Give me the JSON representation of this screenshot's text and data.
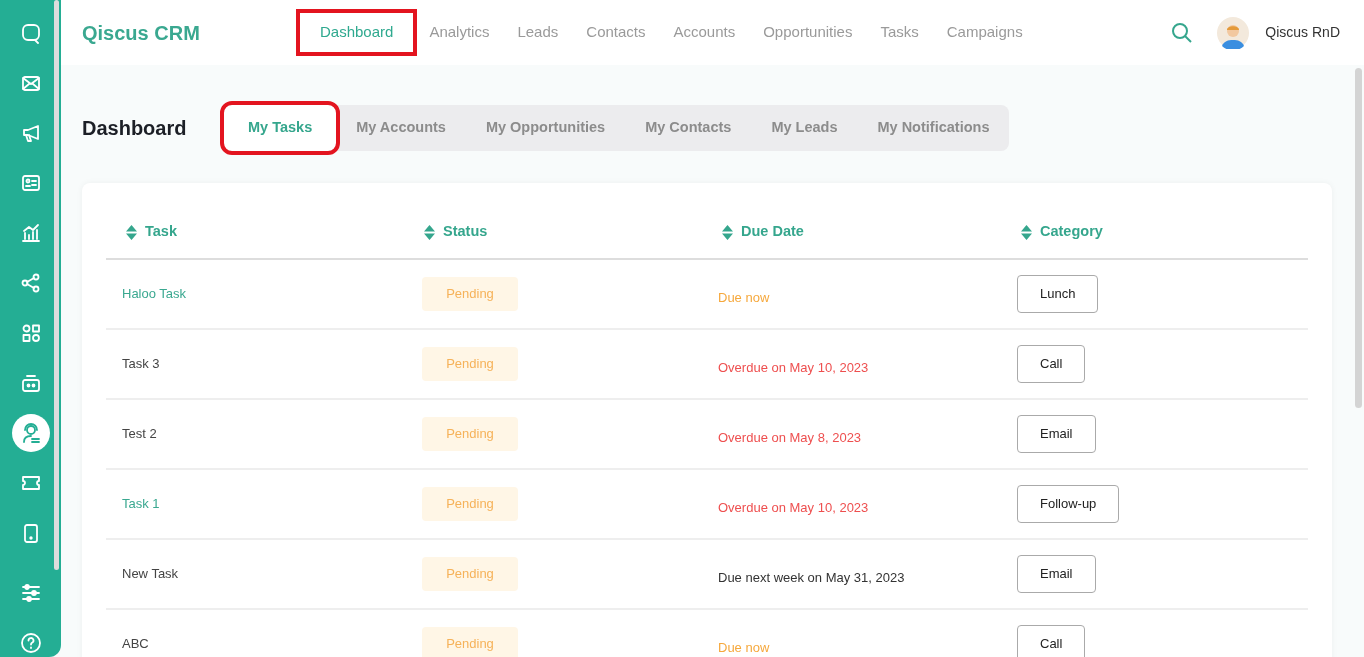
{
  "sidebar": {
    "items": [
      {
        "selected": false
      },
      {
        "selected": false
      },
      {
        "selected": false
      },
      {
        "selected": false
      },
      {
        "selected": false
      },
      {
        "selected": false
      },
      {
        "selected": false
      },
      {
        "selected": false
      },
      {
        "selected": true
      },
      {
        "selected": false
      },
      {
        "selected": false
      }
    ],
    "bottom_items": [
      {
        "selected": false
      },
      {
        "selected": false
      }
    ]
  },
  "brand": "Qiscus CRM",
  "nav": [
    {
      "label": "Dashboard",
      "selected": true,
      "highlighted": true
    },
    {
      "label": "Analytics",
      "selected": false,
      "highlighted": false
    },
    {
      "label": "Leads",
      "selected": false,
      "highlighted": false
    },
    {
      "label": "Contacts",
      "selected": false,
      "highlighted": false
    },
    {
      "label": "Accounts",
      "selected": false,
      "highlighted": false
    },
    {
      "label": "Opportunities",
      "selected": false,
      "highlighted": false
    },
    {
      "label": "Tasks",
      "selected": false,
      "highlighted": false
    },
    {
      "label": "Campaigns",
      "selected": false,
      "highlighted": false
    }
  ],
  "user": {
    "name": "Qiscus RnD"
  },
  "page_title": "Dashboard",
  "tabs": [
    {
      "label": "My Tasks",
      "selected": true,
      "highlighted": true
    },
    {
      "label": "My Accounts",
      "selected": false,
      "highlighted": false
    },
    {
      "label": "My Opportunities",
      "selected": false,
      "highlighted": false
    },
    {
      "label": "My Contacts",
      "selected": false,
      "highlighted": false
    },
    {
      "label": "My Leads",
      "selected": false,
      "highlighted": false
    },
    {
      "label": "My Notifications",
      "selected": false,
      "highlighted": false
    }
  ],
  "table": {
    "columns": [
      "Task",
      "Status",
      "Due Date",
      "Category"
    ],
    "rows": [
      {
        "task": "Haloo Task",
        "link": true,
        "status": "Pending",
        "due": "Due now",
        "kind": "now",
        "category": "Lunch"
      },
      {
        "task": "Task 3",
        "link": false,
        "status": "Pending",
        "due": "Overdue on May 10, 2023",
        "kind": "overdue",
        "category": "Call"
      },
      {
        "task": "Test 2",
        "link": false,
        "status": "Pending",
        "due": "Overdue on May 8, 2023",
        "kind": "overdue",
        "category": "Email"
      },
      {
        "task": "Task 1",
        "link": true,
        "status": "Pending",
        "due": "Overdue on May 10, 2023",
        "kind": "overdue",
        "category": "Follow-up"
      },
      {
        "task": "New Task",
        "link": false,
        "status": "Pending",
        "due": "Due next week on May 31, 2023",
        "kind": "upcoming",
        "category": "Email"
      },
      {
        "task": "ABC",
        "link": false,
        "status": "Pending",
        "due": "Due now",
        "kind": "now",
        "category": "Call"
      }
    ]
  }
}
